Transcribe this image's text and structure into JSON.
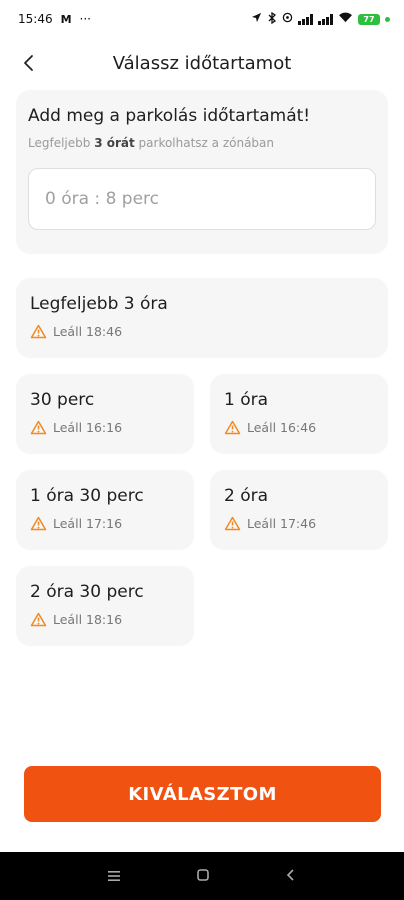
{
  "status_bar": {
    "time": "15:46",
    "mail_icon": "M",
    "more": "···",
    "battery_level": "77"
  },
  "header": {
    "title": "Válassz időtartamot"
  },
  "input_card": {
    "title": "Add meg a parkolás időtartamát!",
    "subtitle_prefix": "Legfeljebb ",
    "subtitle_bold": "3 órát",
    "subtitle_suffix": " parkolhatsz a zónában",
    "placeholder": "0 óra : 8 perc"
  },
  "options": [
    {
      "label": "Legfeljebb 3 óra",
      "stop": "Leáll 18:46"
    },
    {
      "label": "30 perc",
      "stop": "Leáll 16:16"
    },
    {
      "label": "1 óra",
      "stop": "Leáll 16:46"
    },
    {
      "label": "1 óra 30 perc",
      "stop": "Leáll 17:16"
    },
    {
      "label": "2 óra",
      "stop": "Leáll 17:46"
    },
    {
      "label": "2 óra 30 perc",
      "stop": "Leáll 18:16"
    }
  ],
  "primary_button": {
    "label": "KIVÁLASZTOM"
  },
  "colors": {
    "accent": "#f05212",
    "warning": "#f08a24",
    "card_bg": "#f6f6f6"
  },
  "icons": [
    "back-arrow-icon",
    "warning-triangle-icon",
    "wifi-icon",
    "signal-icon",
    "battery-icon",
    "nav-menu-icon",
    "nav-home-icon",
    "nav-back-icon"
  ]
}
